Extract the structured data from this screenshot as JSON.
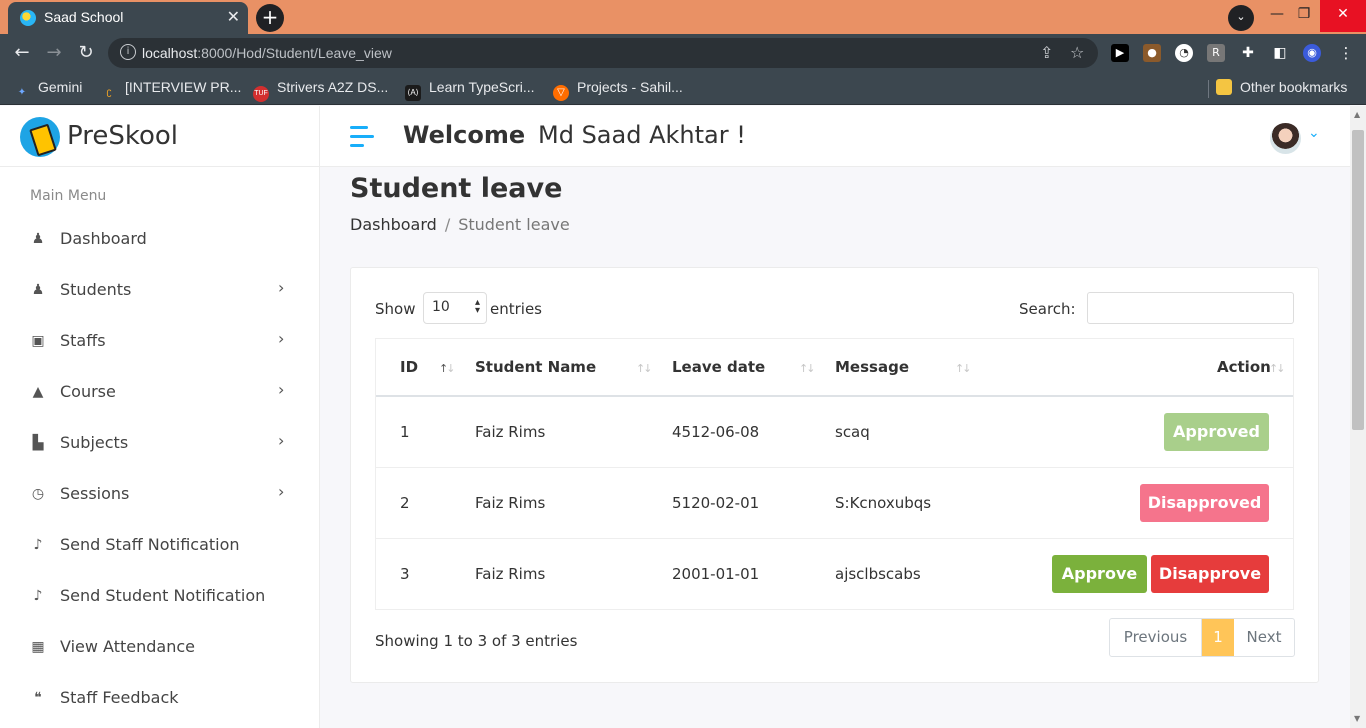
{
  "browser": {
    "tab_title": "Saad School",
    "url_host": "localhost",
    "url_rest": ":8000/Hod/Student/Leave_view",
    "bookmarks": [
      {
        "label": "Gemini"
      },
      {
        "label": "[INTERVIEW PR..."
      },
      {
        "label": "Strivers A2Z DS..."
      },
      {
        "label": "Learn TypeScri..."
      },
      {
        "label": "Projects - Sahil..."
      }
    ],
    "other_bookmarks": "Other bookmarks"
  },
  "header": {
    "logo_text": "PreSkool",
    "welcome": "Welcome",
    "user_name": "Md Saad Akhtar !"
  },
  "sidebar": {
    "title": "Main Menu",
    "items": [
      {
        "label": "Dashboard",
        "icon": "user-graduate-icon"
      },
      {
        "label": "Students",
        "icon": "user-graduate-icon"
      },
      {
        "label": "Staffs",
        "icon": "chalkboard-teacher-icon"
      },
      {
        "label": "Course",
        "icon": "graduation-cap-icon"
      },
      {
        "label": "Subjects",
        "icon": "book-reader-icon"
      },
      {
        "label": "Sessions",
        "icon": "clock-icon"
      },
      {
        "label": "Send Staff Notification",
        "icon": "bell-icon"
      },
      {
        "label": "Send Student Notification",
        "icon": "bell-icon"
      },
      {
        "label": "View Attendance",
        "icon": "calendar-icon"
      },
      {
        "label": "Staff Feedback",
        "icon": "comments-icon"
      }
    ]
  },
  "page": {
    "title": "Student leave",
    "breadcrumb": [
      "Dashboard",
      "/",
      "Student leave"
    ]
  },
  "table_controls": {
    "show_label": "Show",
    "page_length": "10",
    "entries_label": "entries",
    "search_label": "Search:",
    "search_value": ""
  },
  "table": {
    "columns": [
      "ID",
      "Student Name",
      "Leave date",
      "Message",
      "Action"
    ],
    "rows": [
      {
        "id": "1",
        "name": "Faiz Rims",
        "date": "4512-06-08",
        "message": "scaq",
        "status": "Approved"
      },
      {
        "id": "2",
        "name": "Faiz Rims",
        "date": "5120-02-01",
        "message": "S:Kcnoxubqs",
        "status": "Disapproved"
      },
      {
        "id": "3",
        "name": "Faiz Rims",
        "date": "2001-01-01",
        "message": "ajsclbscabs",
        "approve": "Approve",
        "disapprove": "Disapprove"
      }
    ]
  },
  "footer": {
    "info": "Showing 1 to 3 of 3 entries",
    "prev": "Previous",
    "page": "1",
    "next": "Next"
  },
  "colors": {
    "accent": "#18aefa",
    "approved": "#a9cf8b",
    "disapproved": "#f5748c",
    "approve_btn": "#7bb13c",
    "disapprove_btn": "#e63c3c",
    "active_page": "#ffc558"
  }
}
